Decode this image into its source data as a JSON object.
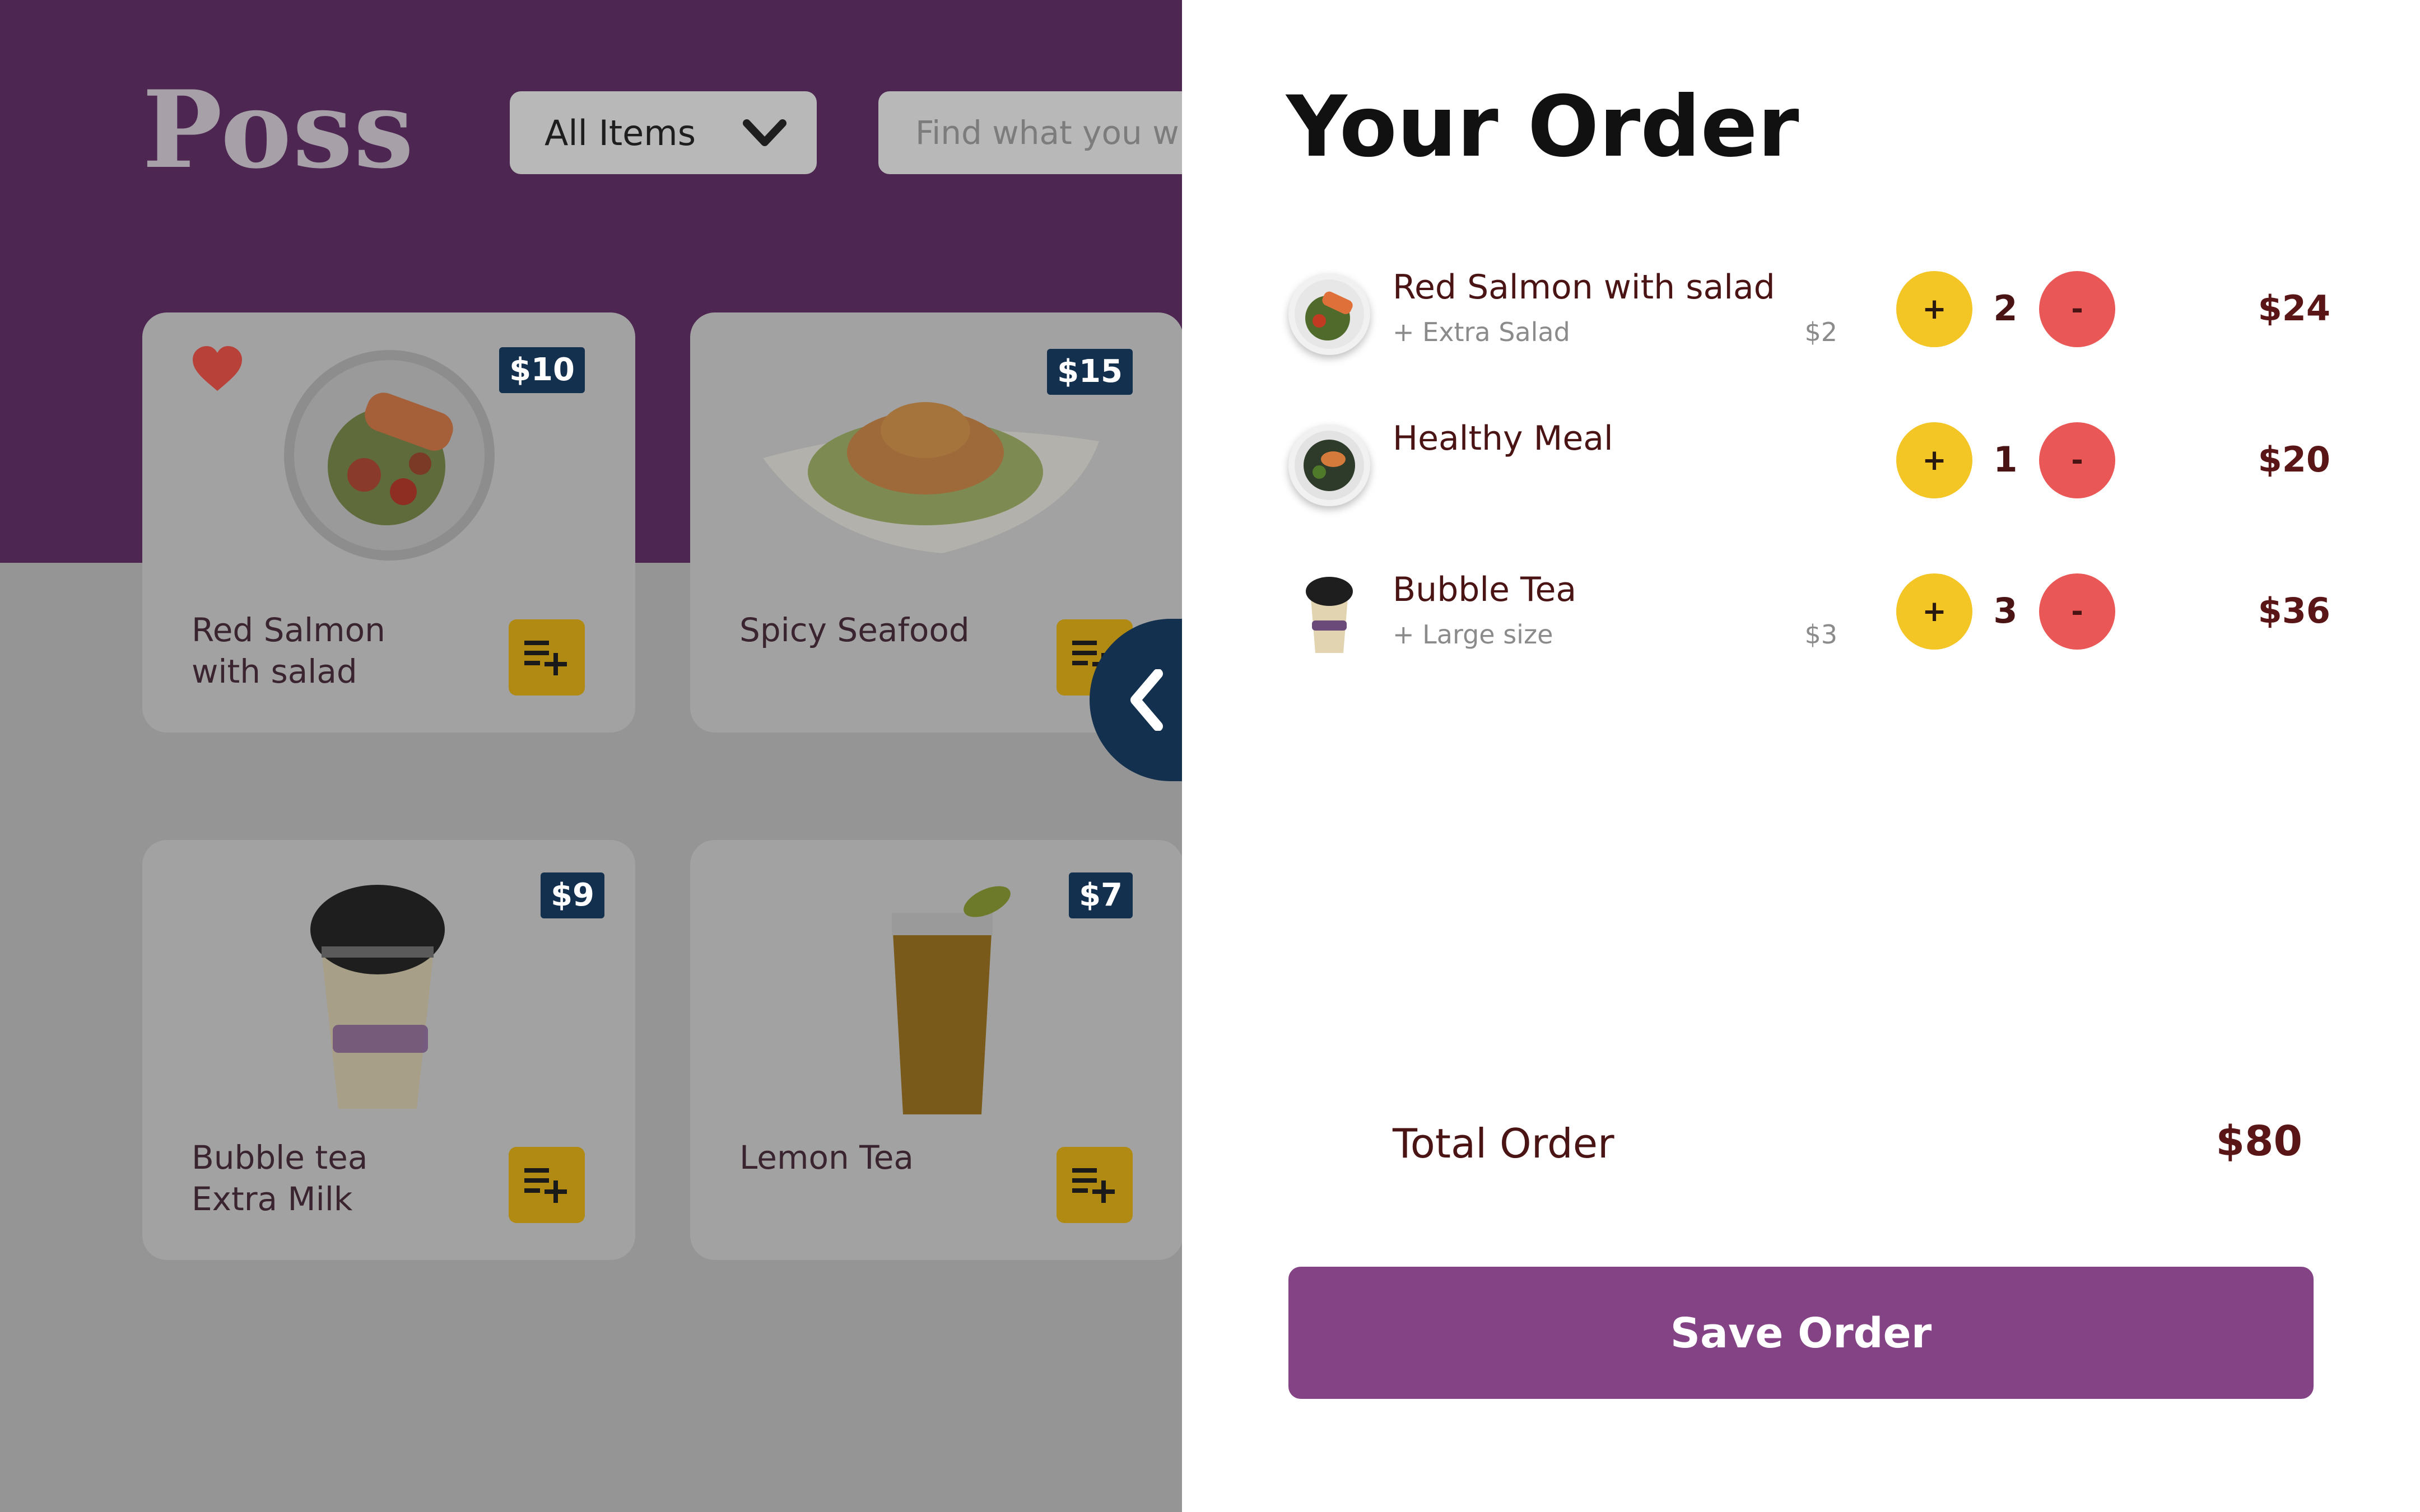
{
  "app": {
    "logo": "Poss"
  },
  "filter": {
    "selected": "All Items",
    "icon": "chevron-down-icon"
  },
  "search": {
    "placeholder": "Find what you w"
  },
  "menu": {
    "items": [
      {
        "name": "Red Salmon\nwith salad",
        "price": "$10",
        "favorite": true,
        "image": "salmon-salad-plate"
      },
      {
        "name": "Spicy Seafood",
        "price": "$15",
        "favorite": false,
        "image": "seafood-plate"
      },
      {
        "name": "Bubble tea\nExtra Milk",
        "price": "$9",
        "favorite": false,
        "image": "bubble-tea-cup"
      },
      {
        "name": "Lemon Tea",
        "price": "$7",
        "favorite": false,
        "image": "lemon-tea-glass"
      }
    ],
    "add_icon": "playlist-add-icon",
    "collapse_icon": "chevron-left-icon"
  },
  "order": {
    "title": "Your Order",
    "items": [
      {
        "name": "Red Salmon with salad",
        "extra": "+ Extra Salad",
        "extra_price": "$2",
        "plus": "+",
        "qty": "2",
        "minus": "-",
        "total": "$24"
      },
      {
        "name": "Healthy Meal",
        "extra": "",
        "extra_price": "",
        "plus": "+",
        "qty": "1",
        "minus": "-",
        "total": "$20"
      },
      {
        "name": "Bubble Tea",
        "extra": "+ Large size",
        "extra_price": "$3",
        "plus": "+",
        "qty": "3",
        "minus": "-",
        "total": "$36"
      }
    ],
    "total_label": "Total Order",
    "total_value": "$80",
    "save_label": "Save Order"
  },
  "colors": {
    "brand_purple": "#844385",
    "header_purple": "#4d2651",
    "navy": "#13304f",
    "plus_yellow": "#f3c525",
    "minus_red": "#e95756",
    "text_maroon": "#4a1414"
  }
}
